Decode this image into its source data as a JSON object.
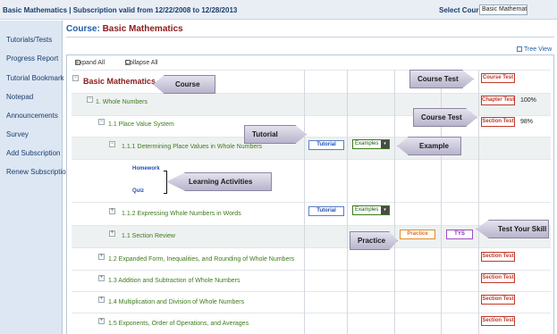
{
  "topbar": {
    "title": "Basic Mathematics | Subscription valid from 12/22/2008 to 12/28/2013",
    "select_label": "Select Course",
    "select_value": "Basic Mathematics"
  },
  "sidebar": {
    "items": [
      {
        "label": "Tutorials/Tests"
      },
      {
        "label": "Progress Report"
      },
      {
        "label": "Tutorial Bookmark"
      },
      {
        "label": "Notepad"
      },
      {
        "label": "Announcements"
      },
      {
        "label": "Survey"
      },
      {
        "label": "Add Subscription"
      },
      {
        "label": "Renew Subscription"
      }
    ]
  },
  "main": {
    "course_label": "Course:",
    "course_name": "Basic Mathematics",
    "tree_view": "Tree View",
    "expand_all": "Expand All",
    "collapse_all": "Collapse All"
  },
  "tree": {
    "root": "Basic Mathematics",
    "whole_numbers": "1. Whole Numbers",
    "place_value": "1.1 Place Value System",
    "determining": "1.1.1 Determining Place Values in Whole Numbers",
    "homework": "Homework",
    "quiz": "Quiz",
    "expressing": "1.1.2 Expressing Whole Numbers in Words",
    "section_review": "1.1 Section Review",
    "expanded_form": "1.2 Expanded Form, Inequalities, and Rounding of Whole Numbers",
    "addition": "1.3 Addition and Subtraction of Whole Numbers",
    "multiplication": "1.4 Multiplication and Division of Whole Numbers",
    "exponents": "1.5 Exponents, Order of Operations, and Averages"
  },
  "buttons": {
    "course_test": "Course Test",
    "chapter_test": "Chapter Test",
    "section_test": "Section Test",
    "tutorial": "Tutorial",
    "examples": "Examples",
    "practice": "Practice",
    "tys": "TYS",
    "dropdown_glyph": "▾"
  },
  "scores": {
    "chapter": "100%",
    "section": "98%"
  },
  "callouts": {
    "course": "Course",
    "course_test_1": "Course Test",
    "course_test_2": "Course Test",
    "tutorial": "Tutorial",
    "example": "Example",
    "learning": "Learning Activities",
    "practice": "Practice",
    "test_skill": "Test Your Skill"
  },
  "toggles": {
    "minus": "−",
    "plus": "+"
  }
}
